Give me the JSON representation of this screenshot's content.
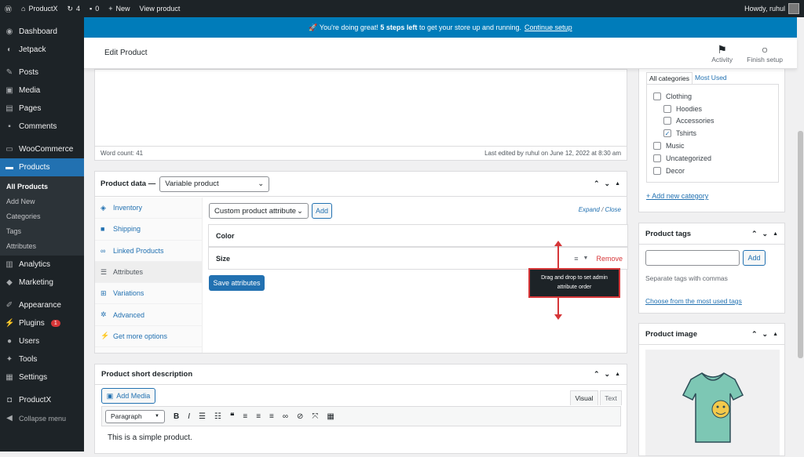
{
  "adminbar": {
    "site_name": "ProductX",
    "updates": "4",
    "comments": "0",
    "new_label": "New",
    "view_label": "View product",
    "howdy": "Howdy, ruhul"
  },
  "sidebar": {
    "items": [
      {
        "label": "Dashboard",
        "icon": "dashboard-icon"
      },
      {
        "label": "Jetpack",
        "icon": "jetpack-icon"
      },
      {
        "label": "Posts",
        "icon": "pin-icon"
      },
      {
        "label": "Media",
        "icon": "media-icon"
      },
      {
        "label": "Pages",
        "icon": "pages-icon"
      },
      {
        "label": "Comments",
        "icon": "comment-icon"
      },
      {
        "label": "WooCommerce",
        "icon": "woo-icon"
      },
      {
        "label": "Products",
        "icon": "archive-icon"
      }
    ],
    "sub_items": [
      "All Products",
      "Add New",
      "Categories",
      "Tags",
      "Attributes"
    ],
    "items2": [
      {
        "label": "Analytics",
        "icon": "chart-icon"
      },
      {
        "label": "Marketing",
        "icon": "megaphone-icon"
      },
      {
        "label": "Appearance",
        "icon": "brush-icon"
      },
      {
        "label": "Plugins",
        "icon": "plugin-icon",
        "badge": "1"
      },
      {
        "label": "Users",
        "icon": "users-icon"
      },
      {
        "label": "Tools",
        "icon": "wrench-icon"
      },
      {
        "label": "Settings",
        "icon": "settings-icon"
      },
      {
        "label": "ProductX",
        "icon": "productx-icon"
      },
      {
        "label": "Collapse menu",
        "icon": "collapse-icon"
      }
    ]
  },
  "notice": {
    "prefix": "🚀 You're doing great!",
    "bold": "5 steps left",
    "suffix": "to get your store up and running.",
    "link": "Continue setup"
  },
  "header": {
    "title": "Edit Product",
    "activity": "Activity",
    "finish_setup": "Finish setup"
  },
  "editor": {
    "word_count": "Word count: 41",
    "last_edited": "Last edited by ruhul on June 12, 2022 at 8:30 am"
  },
  "product_data": {
    "label": "Product data —",
    "type": "Variable product",
    "tabs": [
      {
        "label": "Inventory",
        "icon": "tag-icon"
      },
      {
        "label": "Shipping",
        "icon": "truck-icon"
      },
      {
        "label": "Linked Products",
        "icon": "link-icon"
      },
      {
        "label": "Attributes",
        "icon": "list-icon"
      },
      {
        "label": "Variations",
        "icon": "grid-icon"
      },
      {
        "label": "Advanced",
        "icon": "gear-icon"
      },
      {
        "label": "Get more options",
        "icon": "plugin-icon"
      }
    ],
    "attr_select": "Custom product attribute",
    "add": "Add",
    "expand": "Expand",
    "slash": "/",
    "close": "Close",
    "attributes": [
      "Color",
      "Size"
    ],
    "remove": "Remove",
    "save": "Save attributes",
    "tooltip": "Drag and drop to set admin attribute order"
  },
  "short_desc": {
    "title": "Product short description",
    "add_media": "Add Media",
    "visual": "Visual",
    "text": "Text",
    "format": "Paragraph",
    "content": "This is a simple product."
  },
  "categories": {
    "tab_all": "All categories",
    "tab_used": "Most Used",
    "items": [
      {
        "label": "Clothing",
        "level": 0,
        "checked": false
      },
      {
        "label": "Hoodies",
        "level": 1,
        "checked": false
      },
      {
        "label": "Accessories",
        "level": 1,
        "checked": false
      },
      {
        "label": "Tshirts",
        "level": 1,
        "checked": true
      },
      {
        "label": "Music",
        "level": 0,
        "checked": false
      },
      {
        "label": "Uncategorized",
        "level": 0,
        "checked": false
      },
      {
        "label": "Decor",
        "level": 0,
        "checked": false
      }
    ],
    "add_new": "+ Add new category"
  },
  "tags": {
    "title": "Product tags",
    "add": "Add",
    "hint": "Separate tags with commas",
    "choose": "Choose from the most used tags"
  },
  "product_image": {
    "title": "Product image"
  },
  "colors": {
    "accent": "#2271b1",
    "notice": "#007cba",
    "dark": "#1d2327",
    "red": "#d63638"
  }
}
